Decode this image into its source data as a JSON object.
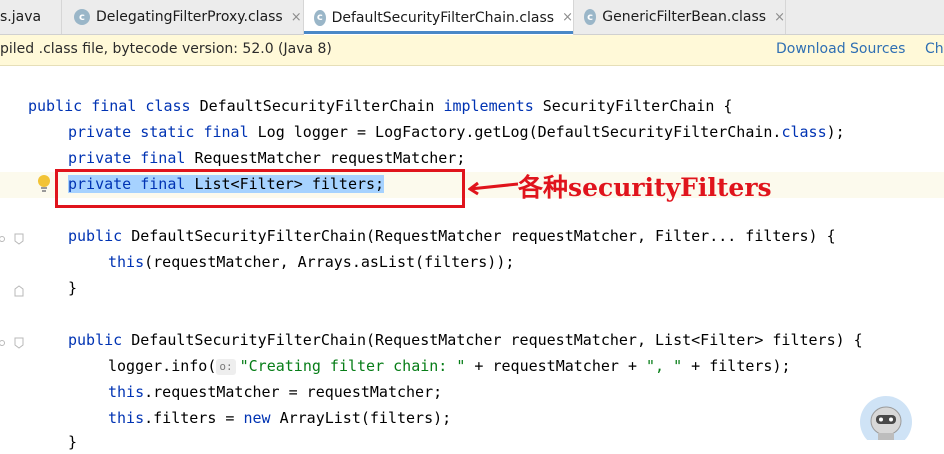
{
  "tabs": [
    {
      "label": "s.java",
      "active": false,
      "icon": "none"
    },
    {
      "label": "DelegatingFilterProxy.class",
      "active": false,
      "icon": "class-icon"
    },
    {
      "label": "DefaultSecurityFilterChain.class",
      "active": true,
      "icon": "class-icon"
    },
    {
      "label": "GenericFilterBean.class",
      "active": false,
      "icon": "class-icon"
    }
  ],
  "tab_close_glyph": "×",
  "class_icon_glyph": "c",
  "banner": {
    "text": "piled .class file, bytecode version: 52.0 (Java 8)",
    "download_sources": "Download Sources",
    "choose_sources": "Ch"
  },
  "code": {
    "l1_kw": "public final class ",
    "l1_name": "DefaultSecurityFilterChain ",
    "l1_kw2": "implements ",
    "l1_rest": "SecurityFilterChain {",
    "l2_kw": "private static final ",
    "l2_rest_a": "Log logger = LogFactory.getLog(DefaultSecurityFilterChain.",
    "l2_kw2": "class",
    "l2_rest_b": ");",
    "l3_kw": "private final ",
    "l3_rest": "RequestMatcher requestMatcher;",
    "l4_kw": "private final ",
    "l4_rest": "List<Filter> filters;",
    "l5_kw": "public ",
    "l5_rest": "DefaultSecurityFilterChain(RequestMatcher requestMatcher, Filter... filters) {",
    "l6_kw": "this",
    "l6_rest": "(requestMatcher, Arrays.asList(filters));",
    "l7": "}",
    "l8_kw": "public ",
    "l8_rest": "DefaultSecurityFilterChain(RequestMatcher requestMatcher, List<Filter> filters) {",
    "l9_a": "logger.info(",
    "l9_hint": "o:",
    "l9_str_a": "\"Creating filter chain: \"",
    "l9_b": " + requestMatcher + ",
    "l9_str_b": "\", \"",
    "l9_c": " + filters);",
    "l10_kw": "this",
    "l10_rest": ".requestMatcher = requestMatcher;",
    "l11_kw": "this",
    "l11_rest_a": ".filters = ",
    "l11_kw2": "new ",
    "l11_rest_b": "ArrayList(filters);",
    "l12": "}"
  },
  "annotation": "各种securityFilters",
  "colors": {
    "keyword": "#0033b3",
    "string": "#067d17",
    "selection": "#a6d2ff",
    "annotation_red": "#e0141c",
    "link": "#2f6fb3"
  }
}
